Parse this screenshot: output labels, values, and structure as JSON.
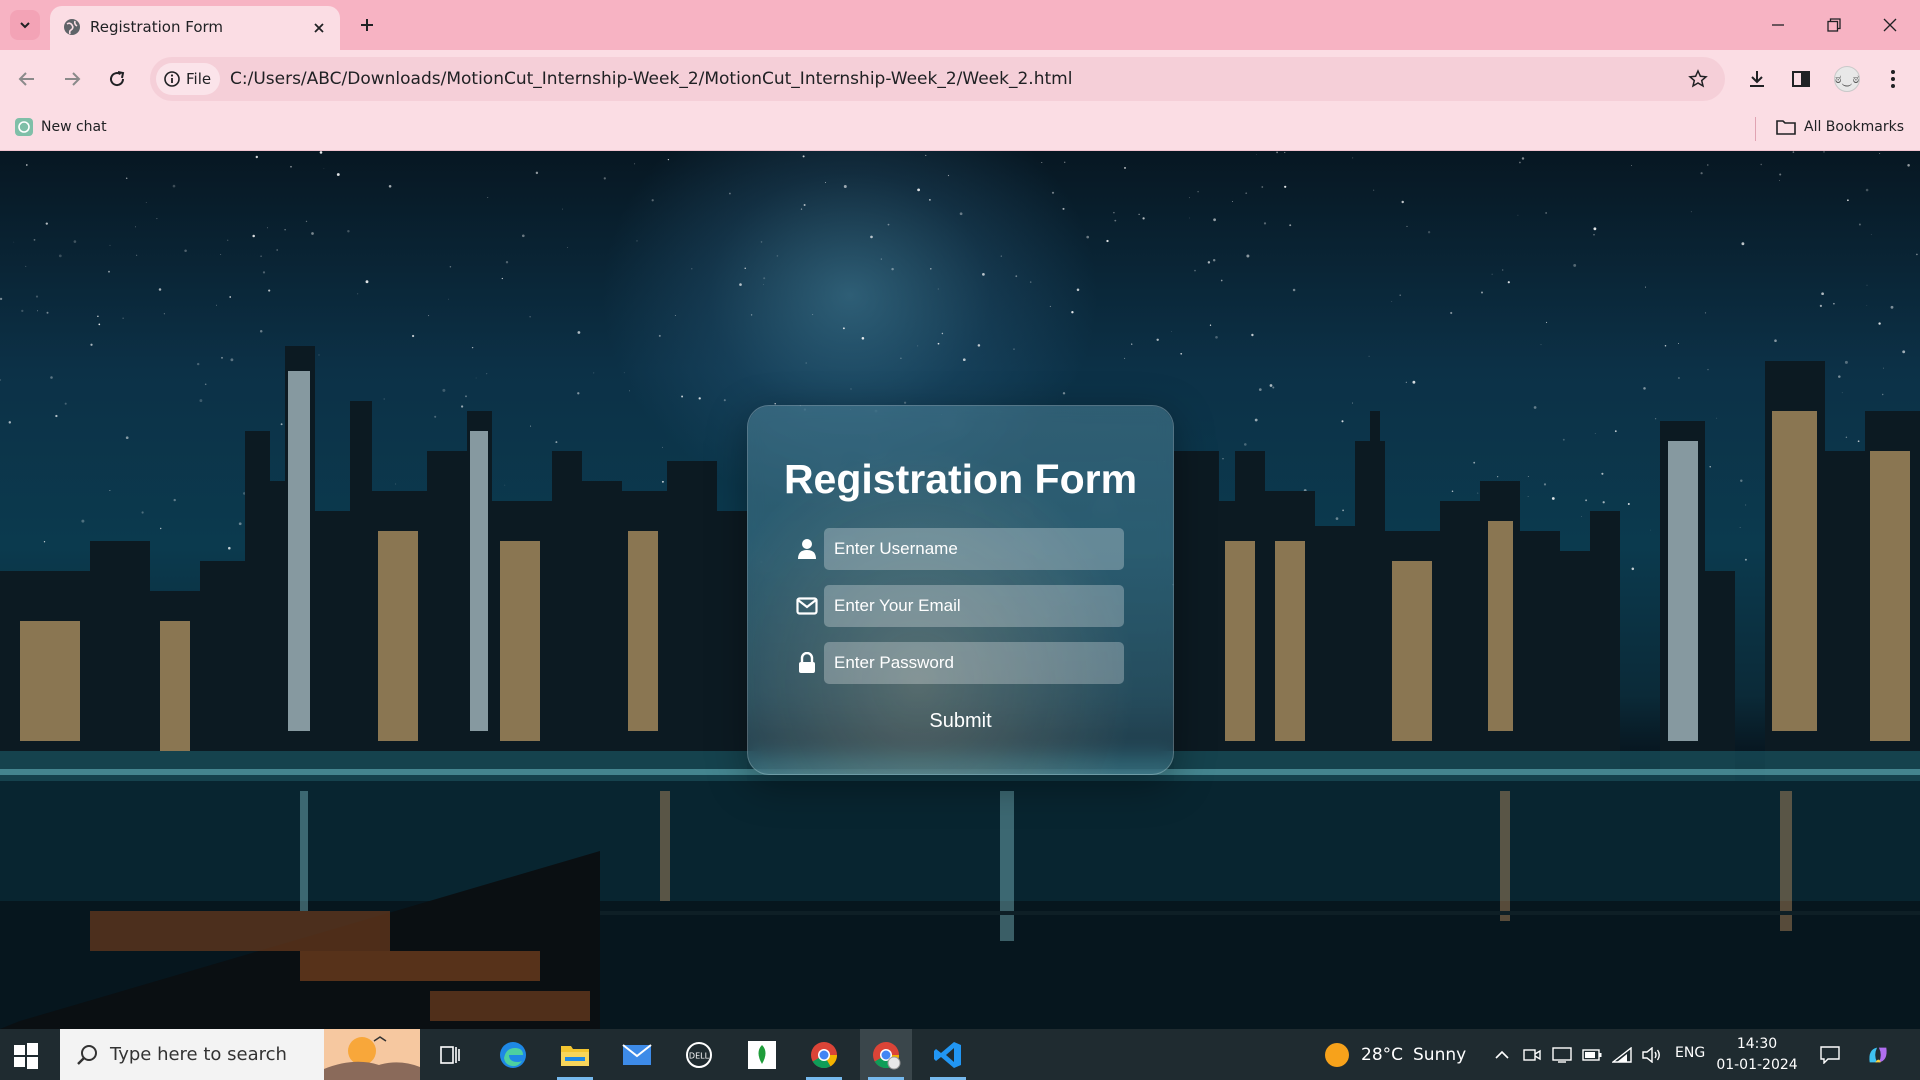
{
  "browser": {
    "tab": {
      "title": "Registration Form",
      "favicon": "globe-icon"
    },
    "site_chip_label": "File",
    "url": "C:/Users/ABC/Downloads/MotionCut_Internship-Week_2/MotionCut_Internship-Week_2/Week_2.html",
    "bookmarks": [
      {
        "label": "New chat",
        "icon": "chatgpt-icon"
      }
    ],
    "all_bookmarks_label": "All Bookmarks",
    "avatar_text": "ಠ‿ಠ"
  },
  "form": {
    "title": "Registration Form",
    "fields": [
      {
        "icon": "user-icon",
        "placeholder": "Enter Username"
      },
      {
        "icon": "envelope-icon",
        "placeholder": "Enter Your Email"
      },
      {
        "icon": "lock-icon",
        "placeholder": "Enter Password"
      }
    ],
    "submit_label": "Submit"
  },
  "taskbar": {
    "search_placeholder": "Type here to search",
    "weather": {
      "temperature": "28°C",
      "condition": "Sunny"
    },
    "language": "ENG",
    "time": "14:30",
    "date": "01-01-2024",
    "pinned_apps": [
      "task-view-icon",
      "edge-icon",
      "file-explorer-icon",
      "mail-icon",
      "dell-icon",
      "leaf-app-icon",
      "chrome-icon",
      "chrome-profile-icon",
      "vscode-icon"
    ]
  },
  "colors": {
    "tabbar": "#f7b3c3",
    "toolbar": "#fbdde4",
    "taskbar": "#1f2b30"
  }
}
